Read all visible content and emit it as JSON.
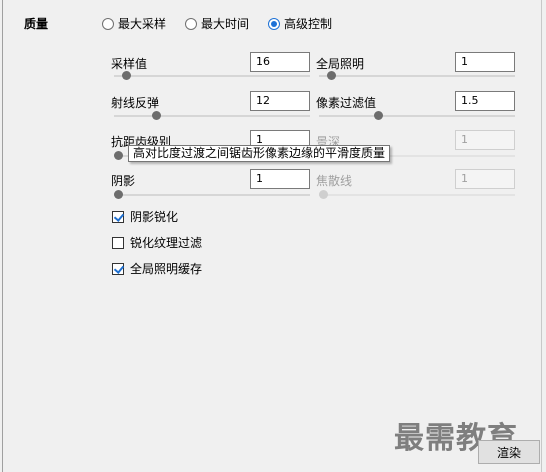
{
  "quality": {
    "label": "质量",
    "modes": [
      {
        "label": "最大采样",
        "selected": false
      },
      {
        "label": "最大时间",
        "selected": false
      },
      {
        "label": "高级控制",
        "selected": true
      }
    ]
  },
  "settings": {
    "sampling": {
      "label": "采样值",
      "value": "16",
      "slider_level": 0.04,
      "enabled": true
    },
    "global_illumination": {
      "label": "全局照明",
      "value": "1",
      "slider_level": 0.04,
      "enabled": true
    },
    "ray_bounce": {
      "label": "射线反弹",
      "value": "12",
      "slider_level": 0.2,
      "enabled": true
    },
    "pixel_filter": {
      "label": "像素过滤值",
      "value": "1.5",
      "slider_level": 0.29,
      "enabled": true
    },
    "antialias": {
      "label": "抗距齿级别",
      "value": "1",
      "slider_level": 0.0,
      "enabled": true
    },
    "depth_of_field": {
      "label": "景深",
      "value": "1",
      "slider_level": 0.0,
      "enabled": false
    },
    "shadow": {
      "label": "阴影",
      "value": "1",
      "slider_level": 0.0,
      "enabled": true
    },
    "caustics": {
      "label": "焦散线",
      "value": "1",
      "slider_level": 0.0,
      "enabled": false
    }
  },
  "tooltip": "高对比度过渡之间锯齿形像素边缘的平滑度质量",
  "options": [
    {
      "label": "阴影锐化",
      "checked": true
    },
    {
      "label": "锐化纹理过滤",
      "checked": false
    },
    {
      "label": "全局照明缓存",
      "checked": true
    }
  ],
  "watermark": "最需教育",
  "render_button": "渲染"
}
